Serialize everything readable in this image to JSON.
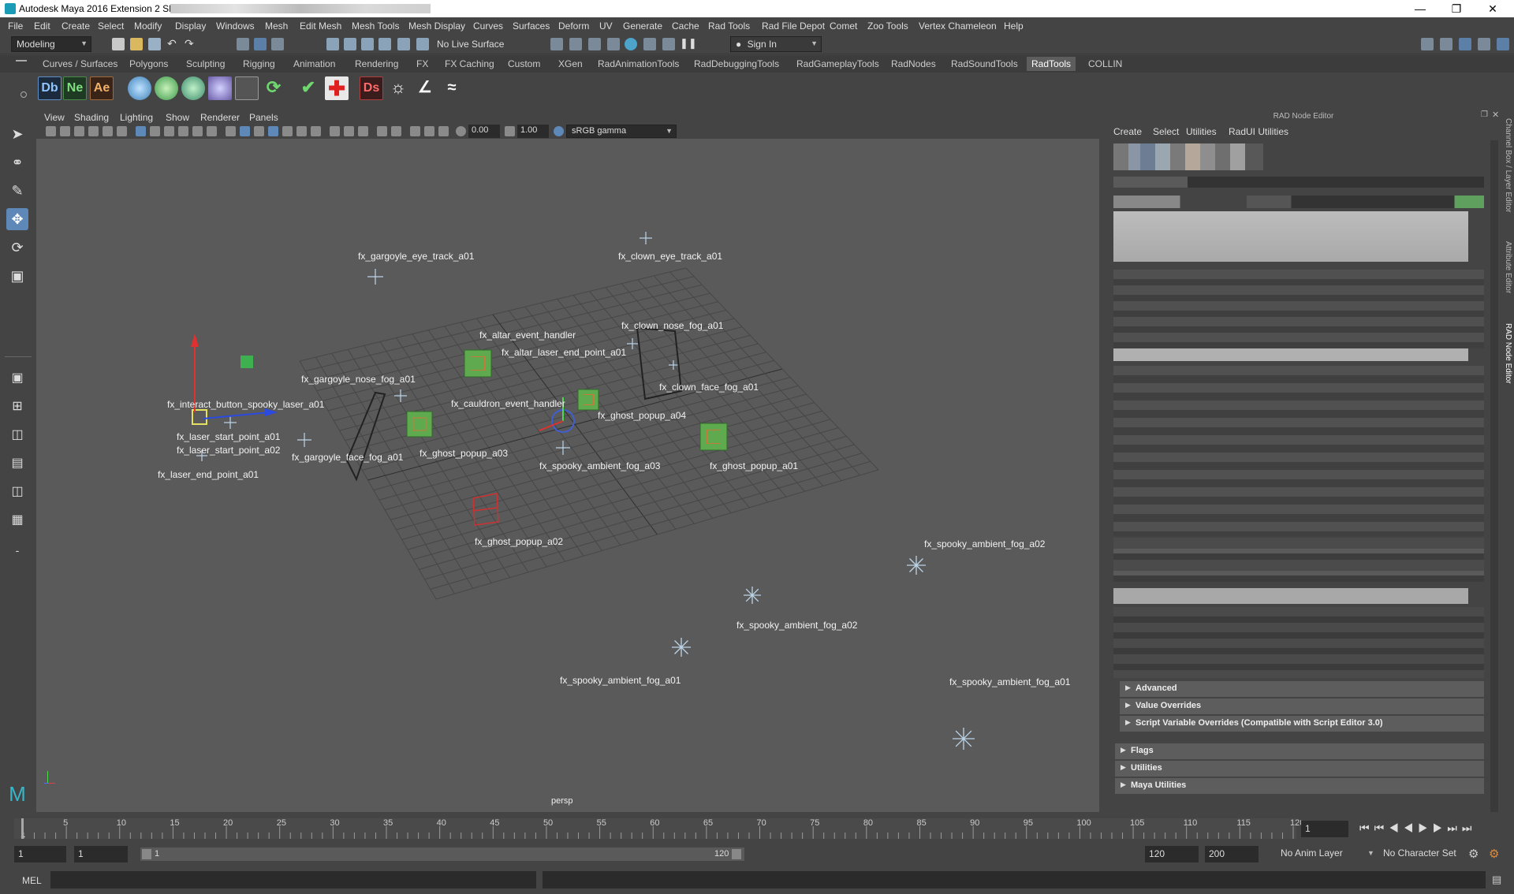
{
  "window": {
    "title": "Autodesk Maya 2016 Extension 2 SP1:"
  },
  "menubar": [
    "File",
    "Edit",
    "Create",
    "Select",
    "Modify",
    "Display",
    "Windows",
    "Mesh",
    "Edit Mesh",
    "Mesh Tools",
    "Mesh Display",
    "Curves",
    "Surfaces",
    "Deform",
    "UV",
    "Generate",
    "Cache",
    "Rad Tools",
    "Rad File Depot",
    "Comet",
    "Zoo Tools",
    "Vertex Chameleon",
    "Help"
  ],
  "statusline": {
    "mode": "Modeling",
    "live_surface": "No Live Surface",
    "sign_in": "Sign In"
  },
  "shelf_tabs": [
    "Curves / Surfaces",
    "Polygons",
    "Sculpting",
    "Rigging",
    "Animation",
    "Rendering",
    "FX",
    "FX Caching",
    "Custom",
    "XGen",
    "RadAnimationTools",
    "RadDebuggingTools",
    "RadGameplayTools",
    "RadNodes",
    "RadSoundTools",
    "RadTools",
    "COLLIN"
  ],
  "active_shelf": "RadTools",
  "shelf_buttons": {
    "db": "Db",
    "ne": "Ne",
    "ae": "Ae",
    "ds": "Ds"
  },
  "viewport": {
    "menu": [
      "View",
      "Shading",
      "Lighting",
      "Show",
      "Renderer",
      "Panels"
    ],
    "exposure": "0.00",
    "gamma": "1.00",
    "color_space": "sRGB gamma",
    "camera": "persp",
    "labels": {
      "gargoyle_eye": "fx_gargoyle_eye_track_a01",
      "clown_eye": "fx_clown_eye_track_a01",
      "clown_nose": "fx_clown_nose_fog_a01",
      "altar_event": "fx_altar_event_handler",
      "altar_laser": "fx_altar_laser_end_point_a01",
      "gargoyle_nose": "fx_gargoyle_nose_fog_a01",
      "clown_face": "fx_clown_face_fog_a01",
      "interact": "fx_interact_button_spooky_laser_a01",
      "cauldron": "fx_cauldron_event_handler",
      "ghost_a04": "fx_ghost_popup_a04",
      "laser_start1": "fx_laser_start_point_a01",
      "laser_start2": "fx_laser_start_point_a02",
      "gargoyle_face": "fx_gargoyle_face_fog_a01",
      "ghost_a03": "fx_ghost_popup_a03",
      "spooky_a03": "fx_spooky_ambient_fog_a03",
      "ghost_a01": "fx_ghost_popup_a01",
      "laser_end": "fx_laser_end_point_a01",
      "ghost_a02": "fx_ghost_popup_a02",
      "spooky_a02_right": "fx_spooky_ambient_fog_a02",
      "spooky_a02_mid": "fx_spooky_ambient_fog_a02",
      "spooky_a01_mid": "fx_spooky_ambient_fog_a01",
      "spooky_a01_right": "fx_spooky_ambient_fog_a01"
    }
  },
  "rad_node_editor": {
    "title": "RAD Node Editor",
    "menu": [
      "Create",
      "Select",
      "Utilities",
      "RadUI Utilities"
    ],
    "sections_inner": [
      "Advanced",
      "Value Overrides",
      "Script Variable Overrides (Compatible with Script Editor 3.0)"
    ],
    "sections_outer": [
      "Flags",
      "Utilities",
      "Maya Utilities"
    ]
  },
  "side_tabs": [
    "Channel Box / Layer Editor",
    "Attribute Editor",
    "RAD Node Editor"
  ],
  "timeline": {
    "ticks": [
      "5",
      "10",
      "15",
      "20",
      "25",
      "30",
      "35",
      "40",
      "45",
      "50",
      "55",
      "60",
      "65",
      "70",
      "75",
      "80",
      "85",
      "90",
      "95",
      "100",
      "105",
      "110",
      "115",
      "120"
    ],
    "first_tick": "1",
    "current_frame": "1",
    "range_start": "1",
    "playback_start": "1",
    "range_slider_start": "1",
    "range_slider_end": "120",
    "playback_end": "120",
    "range_end": "200",
    "anim_layer": "No Anim Layer",
    "character_set": "No Character Set"
  },
  "cmdline": {
    "label": "MEL"
  }
}
